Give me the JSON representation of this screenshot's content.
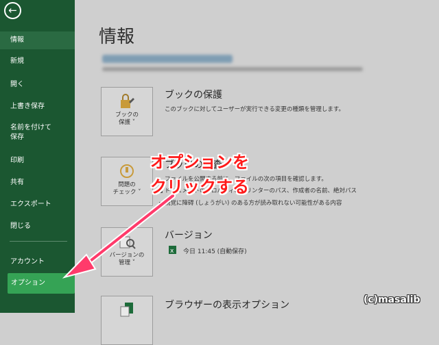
{
  "sidebar": {
    "items": [
      {
        "label": "情報"
      },
      {
        "label": "新規"
      },
      {
        "label": "開く"
      },
      {
        "label": "上書き保存"
      },
      {
        "label": "名前を付けて\n保存"
      },
      {
        "label": "印刷"
      },
      {
        "label": "共有"
      },
      {
        "label": "エクスポート"
      },
      {
        "label": "閉じる"
      },
      {
        "label": "アカウント"
      },
      {
        "label": "オプション"
      }
    ]
  },
  "main": {
    "title": "情報",
    "sections": [
      {
        "tile": "ブックの\n保護 ˅",
        "title": "ブックの保護",
        "text": "このブックに対してユーザーが実行できる変更の種類を管理します。"
      },
      {
        "tile": "問題の\nチェック ˅",
        "title": "ブックの検査",
        "text": "ファイルを公開する前に、ファイルの次の項目を確認します。",
        "bullets": [
          "ドキュメントのプロパティ、プリンターのパス、作成者の名前、絶対パス",
          "視覚に障碍 (しょうがい) のある方が読み取れない可能性がある内容"
        ]
      },
      {
        "tile": "バージョンの\n管理 ˅",
        "title": "バージョン",
        "text": "今日 11:45 (自動保存)"
      },
      {
        "title": "ブラウザーの表示オプション"
      }
    ]
  },
  "callout": {
    "line1": "オプションを",
    "line2": "クリックする"
  },
  "watermark": "(c)masalib",
  "colors": {
    "sidebar": "#1b5731",
    "option_highlight": "#35a355",
    "callout": "#ff1a1a"
  }
}
